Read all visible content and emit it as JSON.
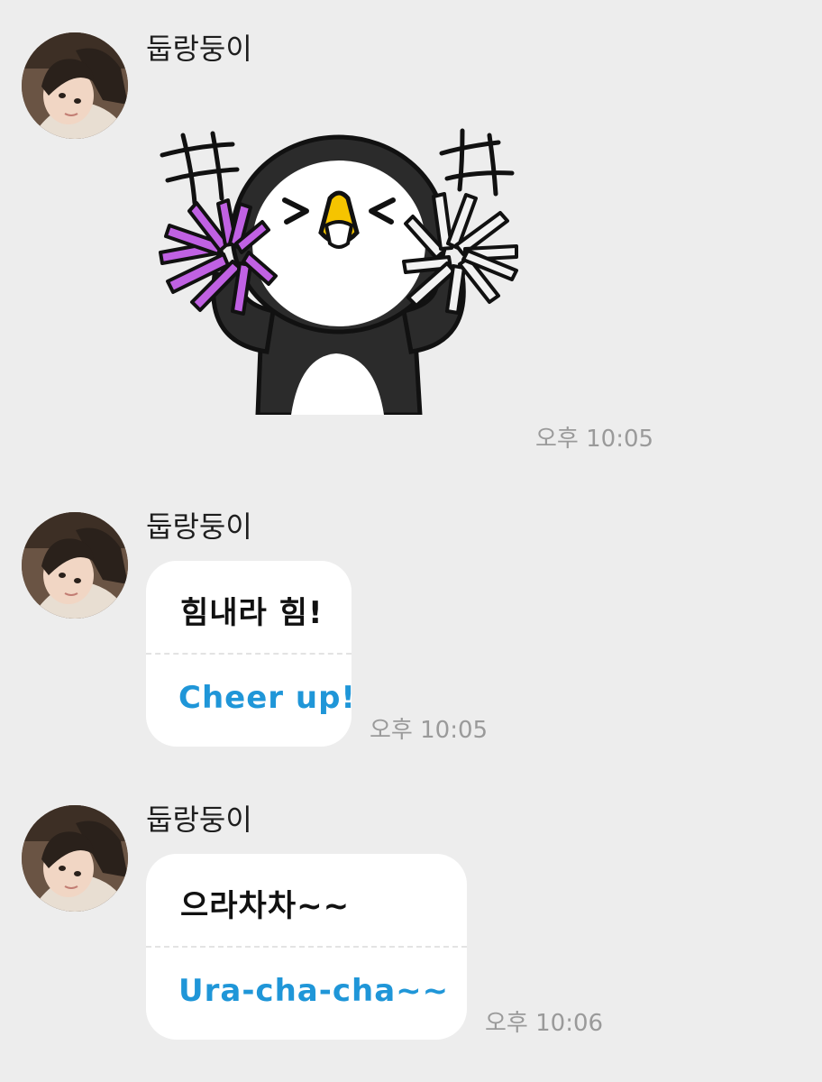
{
  "messages": [
    {
      "sender": "둡랑둥이",
      "type": "sticker",
      "sticker_icon": "cheering-penguin-sticker",
      "time": "오후 10:05"
    },
    {
      "sender": "둡랑둥이",
      "type": "text-card",
      "korean": "힘내라 힘!",
      "english": "Cheer up!",
      "time": "오후 10:05"
    },
    {
      "sender": "둡랑둥이",
      "type": "text-card",
      "korean": "으라차차~~",
      "english": "Ura-cha-cha~~",
      "time": "오후 10:06"
    }
  ],
  "colors": {
    "background": "#ededed",
    "bubble": "#ffffff",
    "english_text": "#1f96d8",
    "timestamp": "#9a9a9a",
    "pompom_left": "#c061e3",
    "pompom_right": "#f2f2f2",
    "beak": "#f5c400"
  }
}
